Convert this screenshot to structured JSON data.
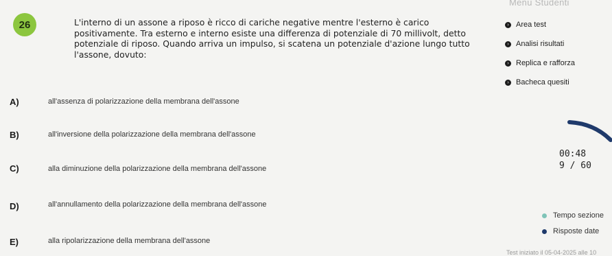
{
  "question": {
    "number": "26",
    "text": "L'interno di un assone a riposo è ricco di cariche negative mentre l'esterno è carico positivamente. Tra esterno e interno esiste una differenza di potenziale di 70 millivolt, detto potenziale di riposo. Quando arriva un impulso, si scatena un potenziale d'azione lungo tutto l'assone, dovuto:"
  },
  "options": [
    {
      "letter": "A)",
      "text": "all'assenza di polarizzazione della membrana dell'assone"
    },
    {
      "letter": "B)",
      "text": "all'inversione della polarizzazione della membrana dell'assone"
    },
    {
      "letter": "C)",
      "text": "alla diminuzione della polarizzazione della membrana dell'assone"
    },
    {
      "letter": "D)",
      "text": "all'annullamento della polarizzazione della membrana dell'assone"
    },
    {
      "letter": "E)",
      "text": "alla ripolarizzazione della membrana dell'assone"
    }
  ],
  "menu": {
    "title": "Menu Studenti",
    "items": [
      {
        "label": "Area test"
      },
      {
        "label": "Analisi risultati"
      },
      {
        "label": "Replica e rafforza"
      },
      {
        "label": "Bacheca quesiti"
      }
    ]
  },
  "status": {
    "timer": "00:48",
    "progress": "9 / 60"
  },
  "legend": [
    {
      "label": "Tempo sezione",
      "color": "#7fc4b8"
    },
    {
      "label": "Risposte date",
      "color": "#1f3a6b"
    }
  ],
  "footer": "Test iniziato il 05-04-2025 alle 10"
}
